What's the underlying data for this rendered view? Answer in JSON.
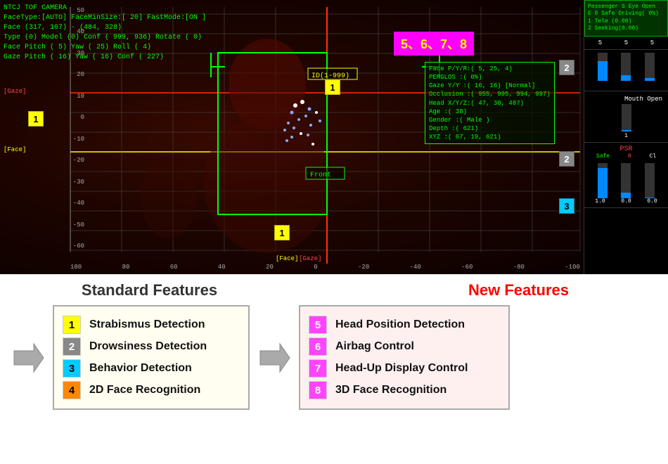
{
  "camera": {
    "title": "NTCJ TOF CAMERA",
    "line1": "FaceType:[AUTO] FaceMinSize:[ 20] FastMode:[ON ]",
    "line2": "Face (317, 107) - (484, 328)",
    "line3": "Type (0) Model (0) Conf ( 999, 936) Rotate ( 0)",
    "line4": "Face Pitch ( 5) Yaw ( 25) Roll ( 4)",
    "line5": "Gaze Pitch ( 16) Yaw ( 16) Conf ( 227)",
    "yaxis": [
      "50",
      "40",
      "30",
      "20",
      "10",
      "0",
      "-10",
      "-20",
      "-30",
      "-40",
      "-50",
      "-60"
    ],
    "xaxis": [
      "100",
      "80",
      "60",
      "40",
      "20",
      "0",
      "-20",
      "-40",
      "-60",
      "-80",
      "-100"
    ],
    "gaze_label": "[Gaze]",
    "face_label": "[Face]",
    "id_label": "ID(1-999)",
    "front_label": "Front",
    "feature_numbers": "5、6、7、8",
    "badge2_pos1": "2",
    "badge2_pos2": "2",
    "badge3_pos": "3",
    "infobox": {
      "line1": "Face P/Y/R:( 5,  25,  4)",
      "line2": "PERGLOS :( 0%)",
      "line3": "Gaze Y/Y :( 16,  16) [Normal]",
      "line4": "Occlusion :( 955, 995, 994, 997)",
      "line5": "Head X/Y/Z:( 47,  30,  487)",
      "line6": "Age      :( 38)",
      "line7": "Gender   :( Male )",
      "line8": "Depth    :( 621)",
      "line9": "XYZ      :( 67,  19, 621)"
    }
  },
  "right_panel": {
    "passenger_title": "Passenger S Eye Open",
    "line1": "E 0 Safe  Driving( 0%)",
    "line2": "1 Tele    (0.00)",
    "line3": "2 Seeking(0.00)",
    "nums": [
      "5",
      "5",
      "5"
    ],
    "mouth_open": "Mouth Open",
    "bar_values": [
      70,
      10,
      5
    ],
    "psr": "PSR",
    "psr_labels": [
      "Safe",
      "8",
      "Cl"
    ],
    "psr_bar_values": [
      85,
      15,
      0
    ],
    "psr_nums": [
      "1.0",
      "0.0",
      "0.0"
    ]
  },
  "bottom": {
    "standard_title": "Standard Features",
    "new_title": "New Features",
    "standard_features": [
      {
        "num": "1",
        "color": "yellow",
        "text": "Strabismus Detection"
      },
      {
        "num": "2",
        "color": "gray",
        "text": "Drowsiness Detection"
      },
      {
        "num": "3",
        "color": "cyan",
        "text": "Behavior Detection"
      },
      {
        "num": "4",
        "color": "orange",
        "text": "2D Face Recognition"
      }
    ],
    "new_features": [
      {
        "num": "5",
        "color": "magenta",
        "text": "Head Position Detection"
      },
      {
        "num": "6",
        "color": "magenta",
        "text": "Airbag Control"
      },
      {
        "num": "7",
        "color": "magenta",
        "text": "Head-Up Display Control"
      },
      {
        "num": "8",
        "color": "magenta",
        "text": "3D Face Recognition"
      }
    ],
    "arrow_char": "➤"
  }
}
